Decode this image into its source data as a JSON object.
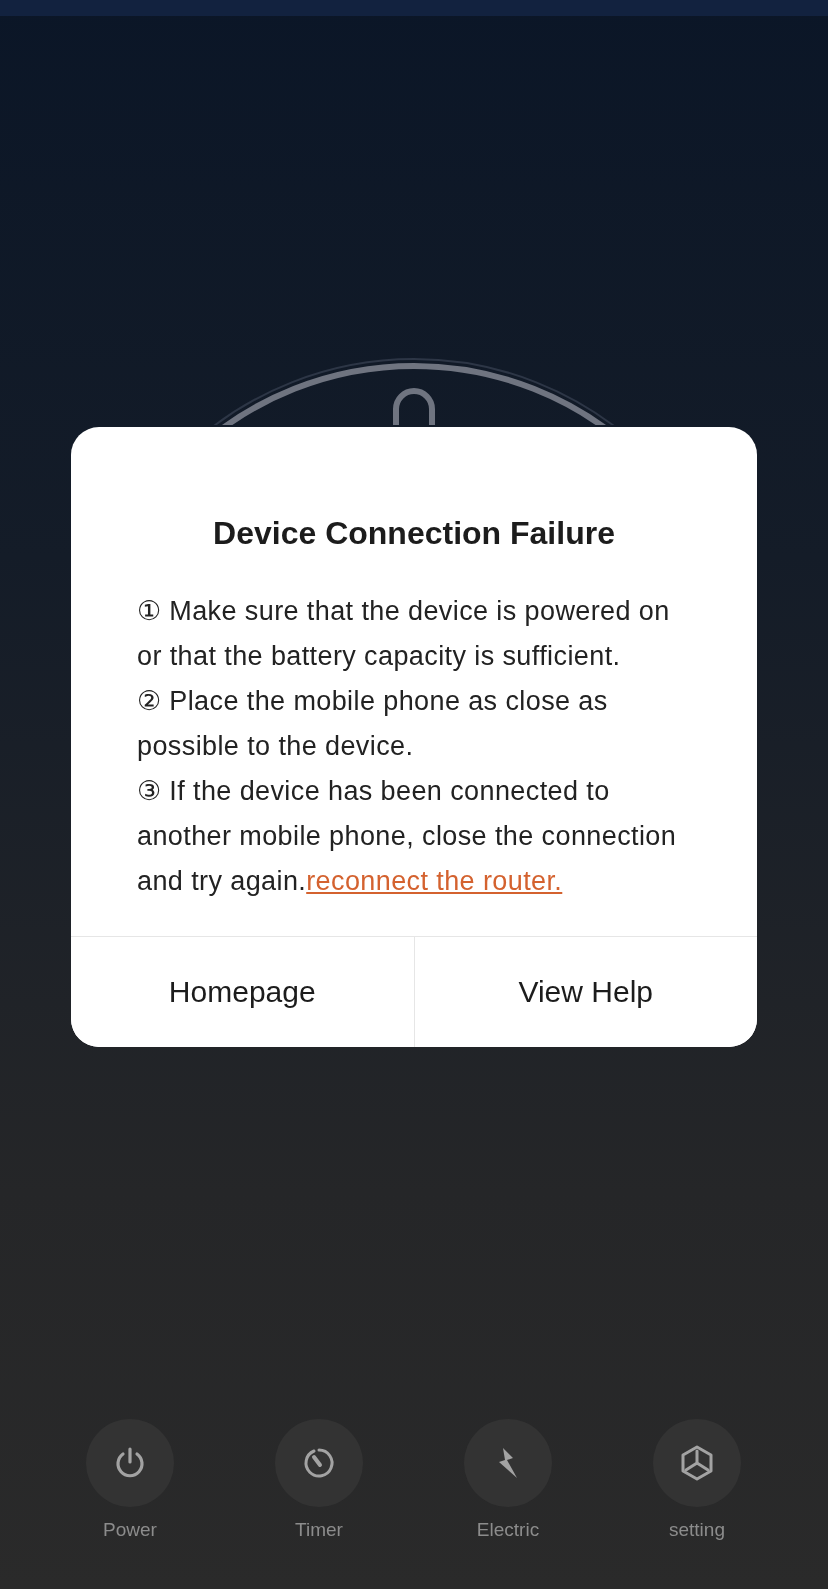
{
  "dialog": {
    "title": "Device Connection Failure",
    "tips": [
      {
        "text": "① Make sure that the device is powered on or that the battery capacity is sufficient."
      },
      {
        "text": "② Place the mobile phone as close as possible to the device."
      },
      {
        "text": "③ If the device has been connected to another mobile phone, close the connection and try again.",
        "link": "reconnect the router."
      }
    ],
    "buttons": [
      {
        "label": "Homepage"
      },
      {
        "label": "View Help"
      }
    ]
  },
  "toolbar": [
    {
      "kind": "power",
      "label": "Power"
    },
    {
      "kind": "timer",
      "label": "Timer"
    },
    {
      "kind": "electric",
      "label": "Electric"
    },
    {
      "kind": "setting",
      "label": "setting"
    }
  ]
}
